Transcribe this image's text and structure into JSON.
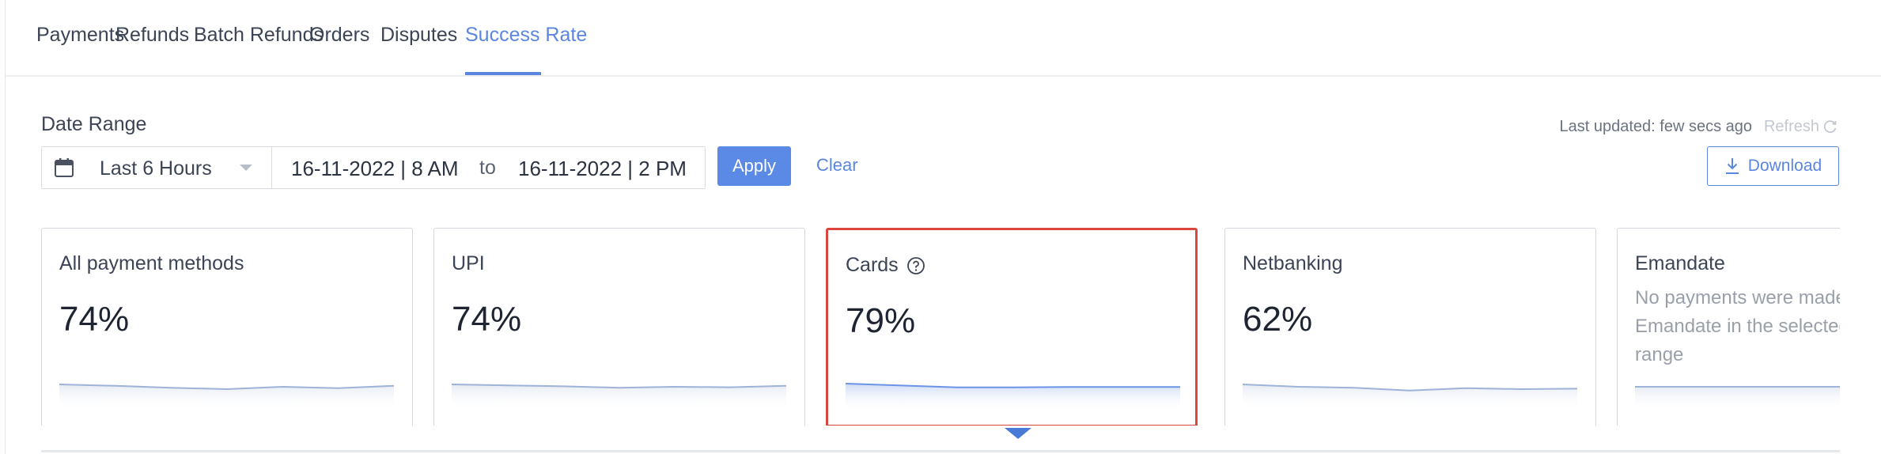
{
  "tabs": [
    {
      "label": "Payments"
    },
    {
      "label": "Refunds"
    },
    {
      "label": "Batch Refunds"
    },
    {
      "label": "Orders"
    },
    {
      "label": "Disputes"
    },
    {
      "label": "Success Rate"
    }
  ],
  "active_tab": "Success Rate",
  "date_range": {
    "label": "Date Range",
    "preset": "Last 6 Hours",
    "from": "16-11-2022 | 8 AM",
    "to_label": "to",
    "until": "16-11-2022 | 2 PM",
    "apply_label": "Apply",
    "clear_label": "Clear"
  },
  "status": {
    "last_updated": "Last updated: few secs ago",
    "refresh_label": "Refresh"
  },
  "download_label": "Download",
  "cards": [
    {
      "title": "All payment methods",
      "value": "74%",
      "trend": [
        0.55,
        0.52,
        0.48,
        0.45,
        0.5,
        0.47,
        0.52
      ]
    },
    {
      "title": "UPI",
      "value": "74%",
      "trend": [
        0.55,
        0.53,
        0.51,
        0.48,
        0.5,
        0.49,
        0.52
      ]
    },
    {
      "title": "Cards",
      "value": "79%",
      "trend": [
        0.6,
        0.56,
        0.52,
        0.52,
        0.53,
        0.53,
        0.53
      ]
    },
    {
      "title": "Netbanking",
      "value": "62%",
      "trend": [
        0.55,
        0.5,
        0.48,
        0.42,
        0.47,
        0.45,
        0.46
      ]
    },
    {
      "title": "Emandate",
      "message": "No payments were made using\nEmandate in the selected time range",
      "trend": [
        0.5,
        0.5,
        0.5,
        0.5,
        0.5,
        0.5,
        0.5
      ]
    }
  ],
  "selected_card": "Cards",
  "colors": {
    "accent": "#5a86e0",
    "selected_border": "#d9463e",
    "spark_line": "#9fb3d9",
    "spark_line_selected": "#6b93e6"
  }
}
